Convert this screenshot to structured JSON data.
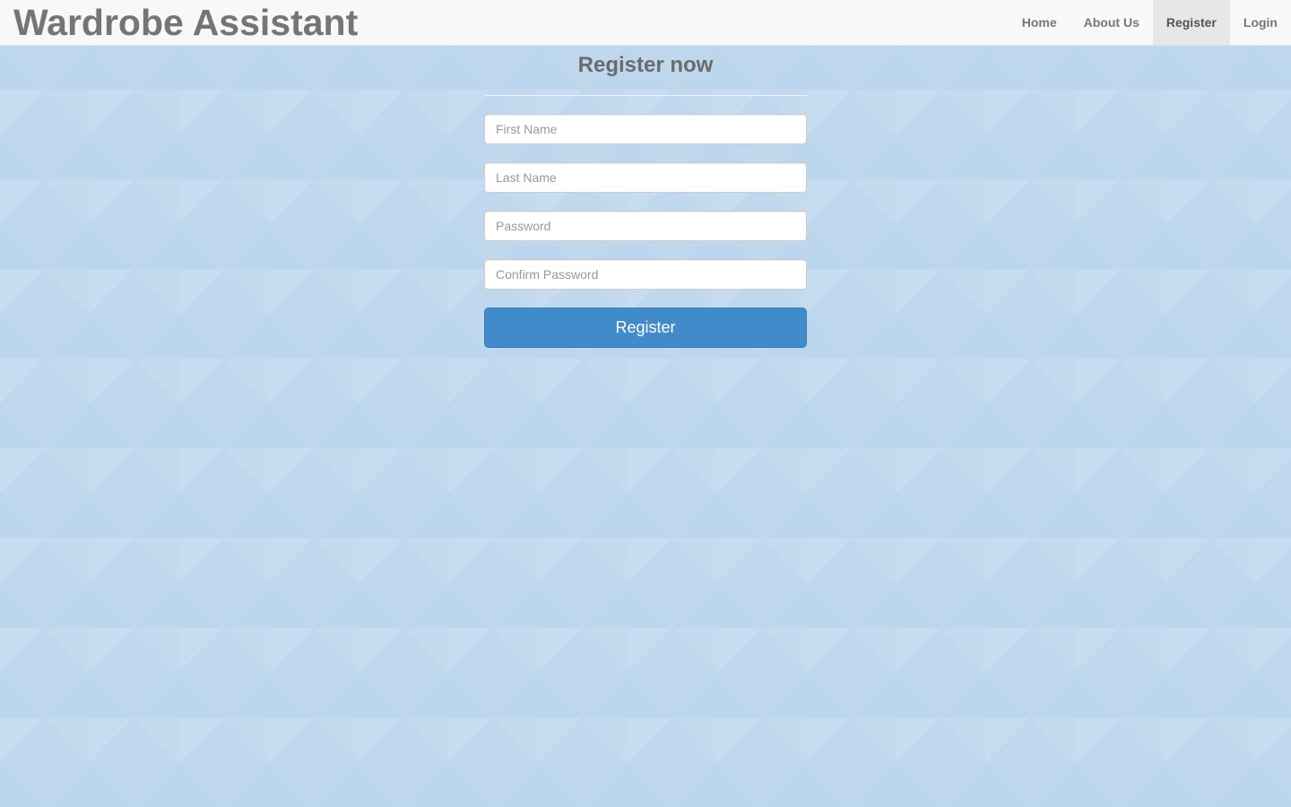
{
  "brand": "Wardrobe Assistant",
  "nav": {
    "home": "Home",
    "about": "About Us",
    "register": "Register",
    "login": "Login"
  },
  "form": {
    "title": "Register now",
    "first_name_placeholder": "First Name",
    "last_name_placeholder": "Last Name",
    "password_placeholder": "Password",
    "confirm_password_placeholder": "Confirm Password",
    "submit_label": "Register"
  },
  "colors": {
    "background": "#bfd8ee",
    "navbar": "#f8f8f8",
    "primary_button": "#428bca",
    "brand_text": "#757575"
  }
}
